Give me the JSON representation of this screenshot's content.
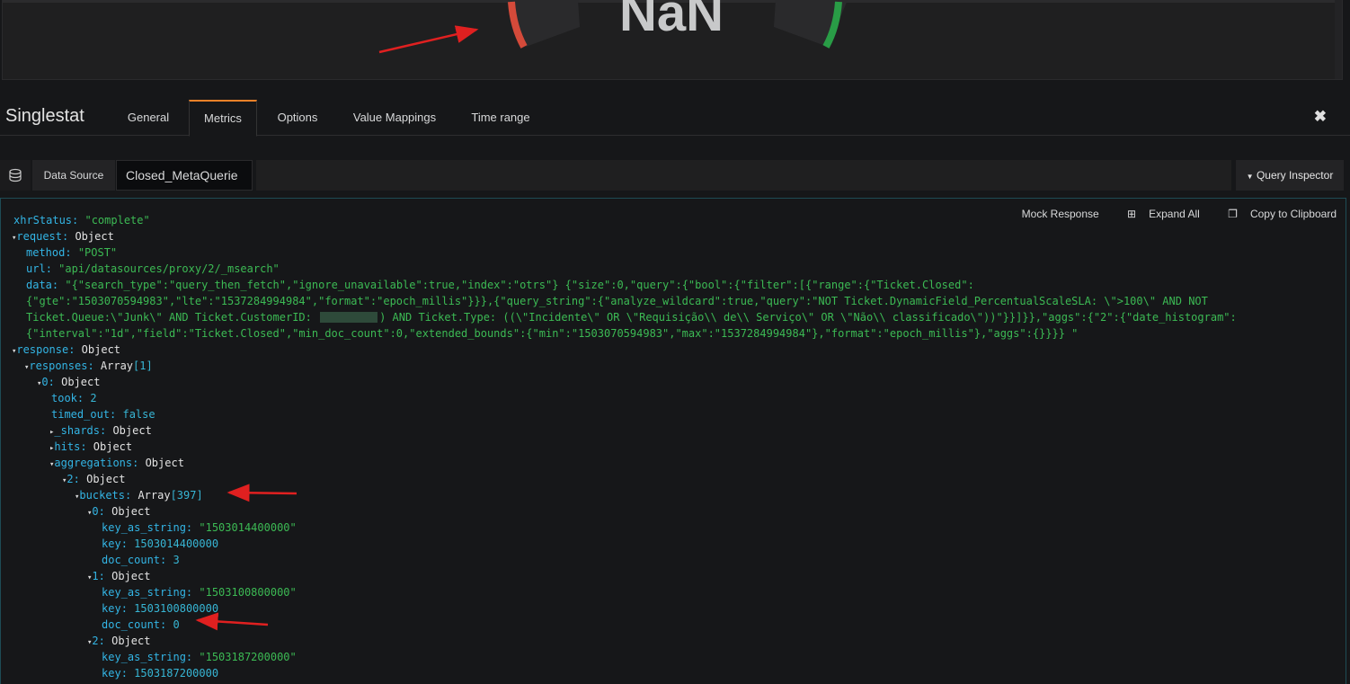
{
  "gauge": {
    "value_text": "NaN"
  },
  "header": {
    "panel_type": "Singlestat",
    "tabs": [
      "General",
      "Metrics",
      "Options",
      "Value Mappings",
      "Time range"
    ],
    "active_tab": "Metrics",
    "close_glyph": "✖"
  },
  "datasource": {
    "label": "Data Source",
    "selected": "Closed_MetaQuerie",
    "query_inspector": "Query Inspector"
  },
  "inspector_actions": {
    "mock_response": "Mock Response",
    "expand_all": "Expand All",
    "copy": "Copy to Clipboard"
  },
  "json_tree": [
    {
      "indent": 0,
      "twisty": "",
      "key": "xhrStatus",
      "value": "\"complete\"",
      "vtype": "s"
    },
    {
      "indent": 0,
      "twisty": "▾",
      "key": "request",
      "value": "Object",
      "vtype": "o"
    },
    {
      "indent": 1,
      "twisty": "",
      "key": "method",
      "value": "\"POST\"",
      "vtype": "s"
    },
    {
      "indent": 1,
      "twisty": "",
      "key": "url",
      "value": "\"api/datasources/proxy/2/_msearch\"",
      "vtype": "s"
    },
    {
      "indent": 1,
      "twisty": "",
      "key": "data",
      "value": "\"{\"search_type\":\"query_then_fetch\",\"ignore_unavailable\":true,\"index\":\"otrs\"} {\"size\":0,\"query\":{\"bool\":{\"filter\":[{\"range\":{\"Ticket.Closed\":",
      "vtype": "s"
    },
    {
      "indent": 1,
      "twisty": "",
      "key": "",
      "value": "{\"gte\":\"1503070594983\",\"lte\":\"1537284994984\",\"format\":\"epoch_millis\"}}},{\"query_string\":{\"analyze_wildcard\":true,\"query\":\"NOT Ticket.DynamicField_PercentualScaleSLA: \\\">100\\\" AND NOT",
      "vtype": "s"
    },
    {
      "indent": 1,
      "twisty": "",
      "key": "",
      "value": "Ticket.Queue:\\\"Junk\\\" AND Ticket.CustomerID: ",
      "value2": ") AND Ticket.Type: ((\\\"Incidente\\\" OR \\\"Requisição\\\\ de\\\\ Serviço\\\" OR \\\"Não\\\\ classificado\\\"))\"}}]}},\"aggs\":{\"2\":{\"date_histogram\":",
      "vtype": "s",
      "redact": true
    },
    {
      "indent": 1,
      "twisty": "",
      "key": "",
      "value": "{\"interval\":\"1d\",\"field\":\"Ticket.Closed\",\"min_doc_count\":0,\"extended_bounds\":{\"min\":\"1503070594983\",\"max\":\"1537284994984\"},\"format\":\"epoch_millis\"},\"aggs\":{}}}} \"",
      "vtype": "s"
    },
    {
      "indent": 0,
      "twisty": "▾",
      "key": "response",
      "value": "Object",
      "vtype": "o"
    },
    {
      "indent": 1,
      "twisty": "▾",
      "key": "responses",
      "value": "Array",
      "count": "[1]",
      "vtype": "o"
    },
    {
      "indent": 2,
      "twisty": "▾",
      "key": "0",
      "value": "Object",
      "vtype": "o"
    },
    {
      "indent": 3,
      "twisty": "",
      "key": "took",
      "value": "2",
      "vtype": "n"
    },
    {
      "indent": 3,
      "twisty": "",
      "key": "timed_out",
      "value": "false",
      "vtype": "n"
    },
    {
      "indent": 3,
      "twisty": "▸",
      "key": "_shards",
      "value": "Object",
      "vtype": "o"
    },
    {
      "indent": 3,
      "twisty": "▸",
      "key": "hits",
      "value": "Object",
      "vtype": "o"
    },
    {
      "indent": 3,
      "twisty": "▾",
      "key": "aggregations",
      "value": "Object",
      "vtype": "o"
    },
    {
      "indent": 4,
      "twisty": "▾",
      "key": "2",
      "value": "Object",
      "vtype": "o"
    },
    {
      "indent": 5,
      "twisty": "▾",
      "key": "buckets",
      "value": "Array",
      "count": "[397]",
      "vtype": "o"
    },
    {
      "indent": 6,
      "twisty": "▾",
      "key": "0",
      "value": "Object",
      "vtype": "o"
    },
    {
      "indent": 7,
      "twisty": "",
      "key": "key_as_string",
      "value": "\"1503014400000\"",
      "vtype": "s"
    },
    {
      "indent": 7,
      "twisty": "",
      "key": "key",
      "value": "1503014400000",
      "vtype": "n"
    },
    {
      "indent": 7,
      "twisty": "",
      "key": "doc_count",
      "value": "3",
      "vtype": "n"
    },
    {
      "indent": 6,
      "twisty": "▾",
      "key": "1",
      "value": "Object",
      "vtype": "o"
    },
    {
      "indent": 7,
      "twisty": "",
      "key": "key_as_string",
      "value": "\"1503100800000\"",
      "vtype": "s"
    },
    {
      "indent": 7,
      "twisty": "",
      "key": "key",
      "value": "1503100800000",
      "vtype": "n"
    },
    {
      "indent": 7,
      "twisty": "",
      "key": "doc_count",
      "value": "0",
      "vtype": "n"
    },
    {
      "indent": 6,
      "twisty": "▾",
      "key": "2",
      "value": "Object",
      "vtype": "o"
    },
    {
      "indent": 7,
      "twisty": "",
      "key": "key_as_string",
      "value": "\"1503187200000\"",
      "vtype": "s"
    },
    {
      "indent": 7,
      "twisty": "",
      "key": "key",
      "value": "1503187200000",
      "vtype": "n"
    }
  ],
  "colors": {
    "accent": "#ed8128",
    "string": "#3cba54",
    "key": "#33b5e5",
    "annotation": "#e02020"
  }
}
